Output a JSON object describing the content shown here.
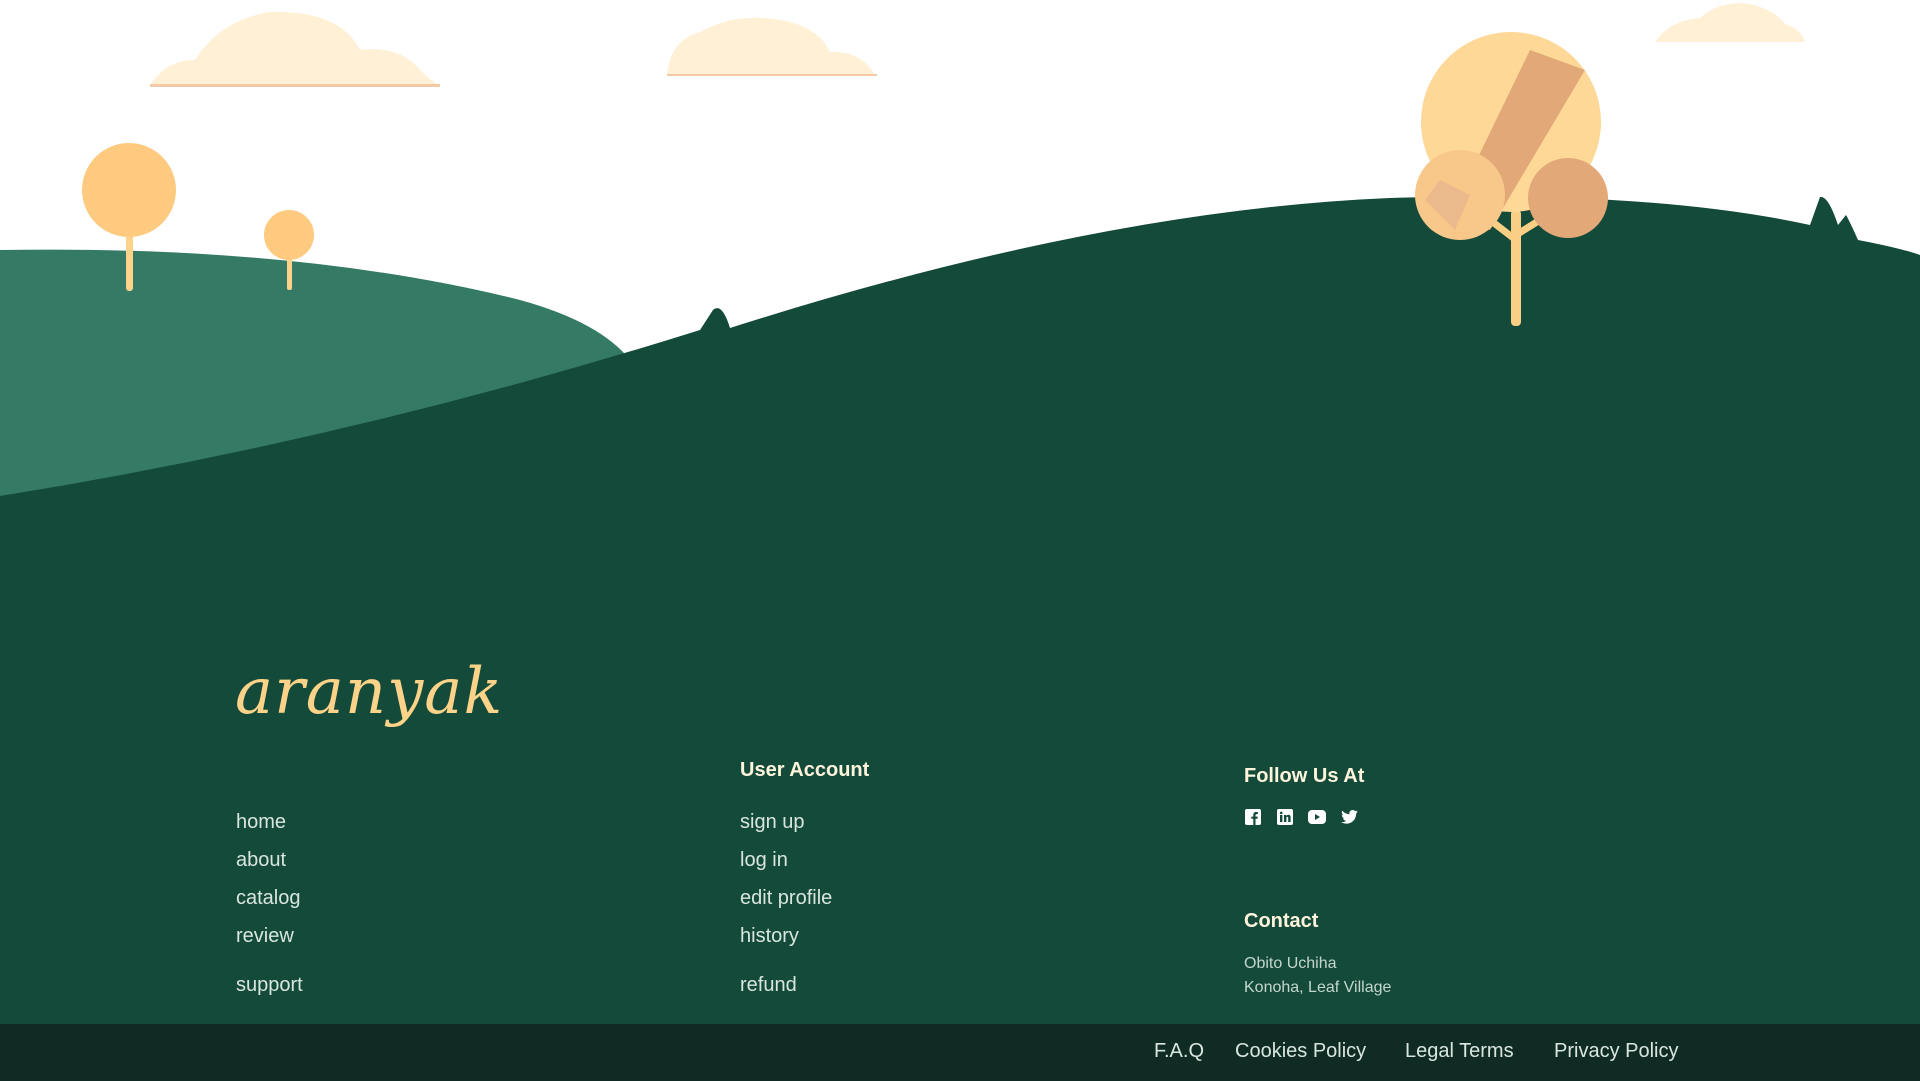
{
  "brand": {
    "logo_text": "aranyak"
  },
  "colors": {
    "sky": "#ffffff",
    "cloud": "#fff0d6",
    "hill_light": "#357a64",
    "hill_dark": "#144a3a",
    "footer_dark": "#0f2b24",
    "tree_yellow": "#fdd38a",
    "tree_orange": "#e3a877"
  },
  "nav": {
    "items": [
      {
        "label": "home"
      },
      {
        "label": "about"
      },
      {
        "label": "catalog"
      },
      {
        "label": "review"
      },
      {
        "label": "support"
      }
    ]
  },
  "user_account": {
    "title": "User Account",
    "items": [
      {
        "label": "sign up"
      },
      {
        "label": "log in"
      },
      {
        "label": "edit profile"
      },
      {
        "label": "history"
      },
      {
        "label": "refund"
      }
    ]
  },
  "follow": {
    "title": "Follow Us At",
    "icons": [
      "facebook-icon",
      "linkedin-icon",
      "youtube-icon",
      "twitter-icon"
    ]
  },
  "contact": {
    "title": "Contact",
    "name": "Obito Uchiha",
    "address": "Konoha, Leaf Village"
  },
  "bottom_links": [
    {
      "label": "F.A.Q"
    },
    {
      "label": "Cookies Policy"
    },
    {
      "label": "Legal Terms"
    },
    {
      "label": "Privacy Policy"
    }
  ]
}
